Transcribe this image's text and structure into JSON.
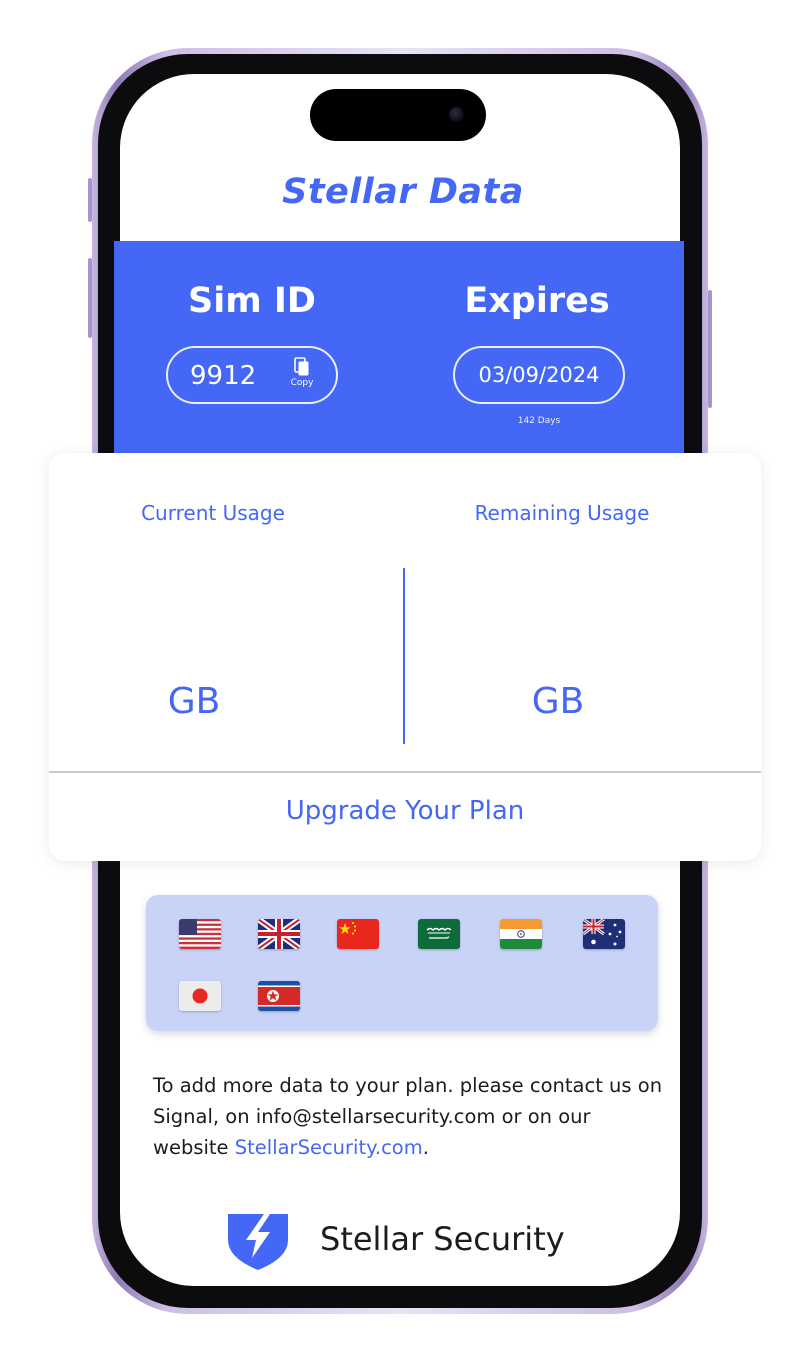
{
  "app": {
    "title": "Stellar Data"
  },
  "sim": {
    "label": "Sim ID",
    "value": "9912",
    "copy_label": "Copy"
  },
  "expires": {
    "label": "Expires",
    "date": "03/09/2024",
    "days_left": "142 Days"
  },
  "usage": {
    "current_label": "Current Usage",
    "remaining_label": "Remaining Usage",
    "current_unit": "GB",
    "remaining_unit": "GB",
    "upgrade_label": "Upgrade Your Plan"
  },
  "flags": [
    {
      "country": "united-states",
      "icon": "us-flag-icon"
    },
    {
      "country": "united-kingdom",
      "icon": "uk-flag-icon"
    },
    {
      "country": "china",
      "icon": "china-flag-icon"
    },
    {
      "country": "saudi-arabia",
      "icon": "saudi-arabia-flag-icon"
    },
    {
      "country": "india",
      "icon": "india-flag-icon"
    },
    {
      "country": "australia",
      "icon": "australia-flag-icon"
    },
    {
      "country": "japan",
      "icon": "japan-flag-icon"
    },
    {
      "country": "north-korea",
      "icon": "north-korea-flag-icon"
    }
  ],
  "contact": {
    "text_before": "To add more data to your plan. please contact us on Signal, on info@stellarsecurity.com or on our website ",
    "link_text": "StellarSecurity.com",
    "text_after": "."
  },
  "brand": {
    "name": "Stellar Security",
    "logo_icon": "shield-bolt-logo-icon"
  },
  "colors": {
    "accent": "#4468f5",
    "card": "#ffffff",
    "flags_panel": "#c9d3f7",
    "frame": "#b7a5d6",
    "text": "#1c1c1f"
  }
}
